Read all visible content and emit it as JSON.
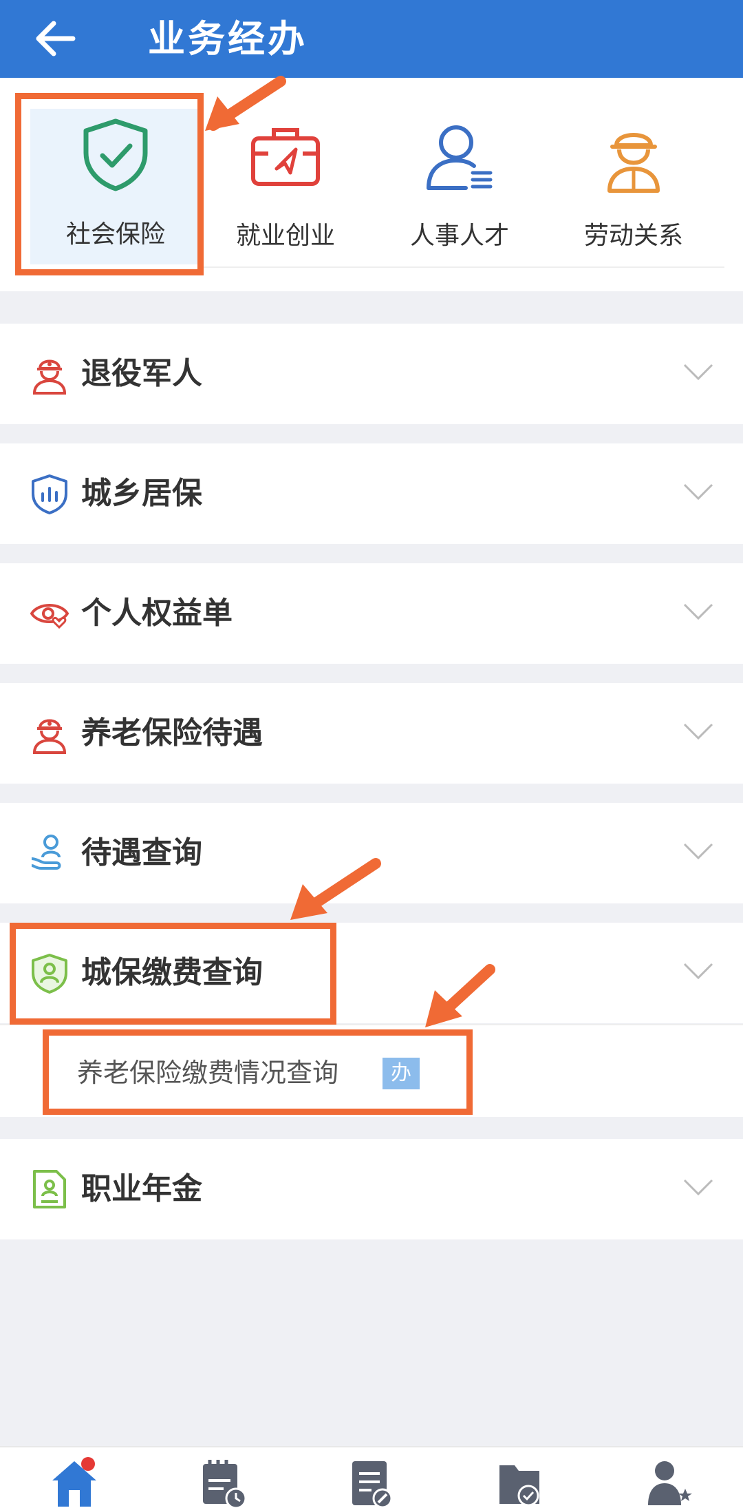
{
  "header": {
    "title": "业务经办",
    "background_color": "#3178d4",
    "back_icon": "arrow-left-icon"
  },
  "categories": [
    {
      "label": "社会保险",
      "icon": "shield-check-icon",
      "selected": true,
      "color": "#2e9b6b"
    },
    {
      "label": "就业创业",
      "icon": "briefcase-icon",
      "selected": false,
      "color": "#e0413b"
    },
    {
      "label": "人事人才",
      "icon": "person-list-icon",
      "selected": false,
      "color": "#3b6fc4"
    },
    {
      "label": "劳动关系",
      "icon": "worker-helmet-icon",
      "selected": false,
      "color": "#e8953b"
    }
  ],
  "sections": [
    {
      "label": "退役军人",
      "icon": "soldier-icon",
      "expanded": false
    },
    {
      "label": "城乡居保",
      "icon": "shield-chart-icon",
      "expanded": false
    },
    {
      "label": "个人权益单",
      "icon": "eye-heart-icon",
      "expanded": false
    },
    {
      "label": "养老保险待遇",
      "icon": "soldier-icon",
      "expanded": false
    },
    {
      "label": "待遇查询",
      "icon": "hand-person-icon",
      "expanded": false
    },
    {
      "label": "城保缴费查询",
      "icon": "shield-person-icon",
      "expanded": true,
      "items": [
        {
          "label": "养老保险缴费情况查询",
          "badge": "办"
        }
      ]
    },
    {
      "label": "职业年金",
      "icon": "document-person-icon",
      "expanded": false
    }
  ],
  "tabbar": [
    {
      "icon": "home-icon",
      "active": true,
      "has_dot": true
    },
    {
      "icon": "calendar-clock-icon",
      "active": false
    },
    {
      "icon": "document-pen-icon",
      "active": false
    },
    {
      "icon": "folder-check-icon",
      "active": false
    },
    {
      "icon": "user-stars-icon",
      "active": false
    }
  ],
  "accent_colors": {
    "annotation_orange": "#f06a35",
    "selected_bg": "#eaf3fc",
    "badge_blue": "#8cbcec"
  }
}
